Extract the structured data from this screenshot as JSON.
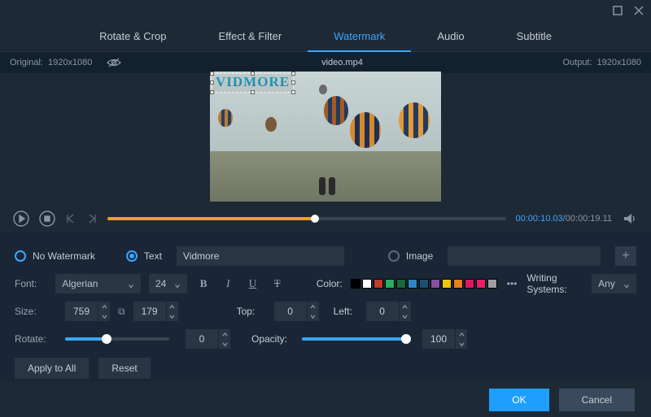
{
  "window": {
    "maximize_icon": "maximize",
    "close_icon": "close"
  },
  "tabs": {
    "items": [
      "Rotate & Crop",
      "Effect & Filter",
      "Watermark",
      "Audio",
      "Subtitle"
    ],
    "active_index": 2
  },
  "topbar": {
    "original_label": "Original:",
    "original_res": "1920x1080",
    "filename": "video.mp4",
    "output_label": "Output:",
    "output_res": "1920x1080"
  },
  "watermark_text_rendered": "Vidmore",
  "playback": {
    "current_time": "00:00:10.03",
    "total_time": "00:00:19.11"
  },
  "radios": {
    "no_watermark": "No Watermark",
    "text": "Text",
    "image": "Image",
    "selected": "text"
  },
  "text_value": "Vidmore",
  "font": {
    "label": "Font:",
    "family": "Algerian",
    "size": "24",
    "color_label": "Color:",
    "writing_label": "Writing Systems:",
    "writing_value": "Any",
    "swatches": [
      "#000000",
      "#ffffff",
      "#c0392b",
      "#27ae60",
      "#186a3b",
      "#2e86c1",
      "#1b4f72",
      "#884ea0",
      "#f1c40f",
      "#e67e22",
      "#d81b60",
      "#e91e63",
      "#9e9e9e"
    ]
  },
  "size": {
    "label": "Size:",
    "w": "759",
    "h": "179"
  },
  "top": {
    "label": "Top:",
    "value": "0"
  },
  "left": {
    "label": "Left:",
    "value": "0"
  },
  "rotate": {
    "label": "Rotate:",
    "value": "0",
    "percent": 40
  },
  "opacity": {
    "label": "Opacity:",
    "value": "100",
    "percent": 100
  },
  "actions": {
    "apply_all": "Apply to All",
    "reset": "Reset"
  },
  "footer": {
    "ok": "OK",
    "cancel": "Cancel"
  }
}
